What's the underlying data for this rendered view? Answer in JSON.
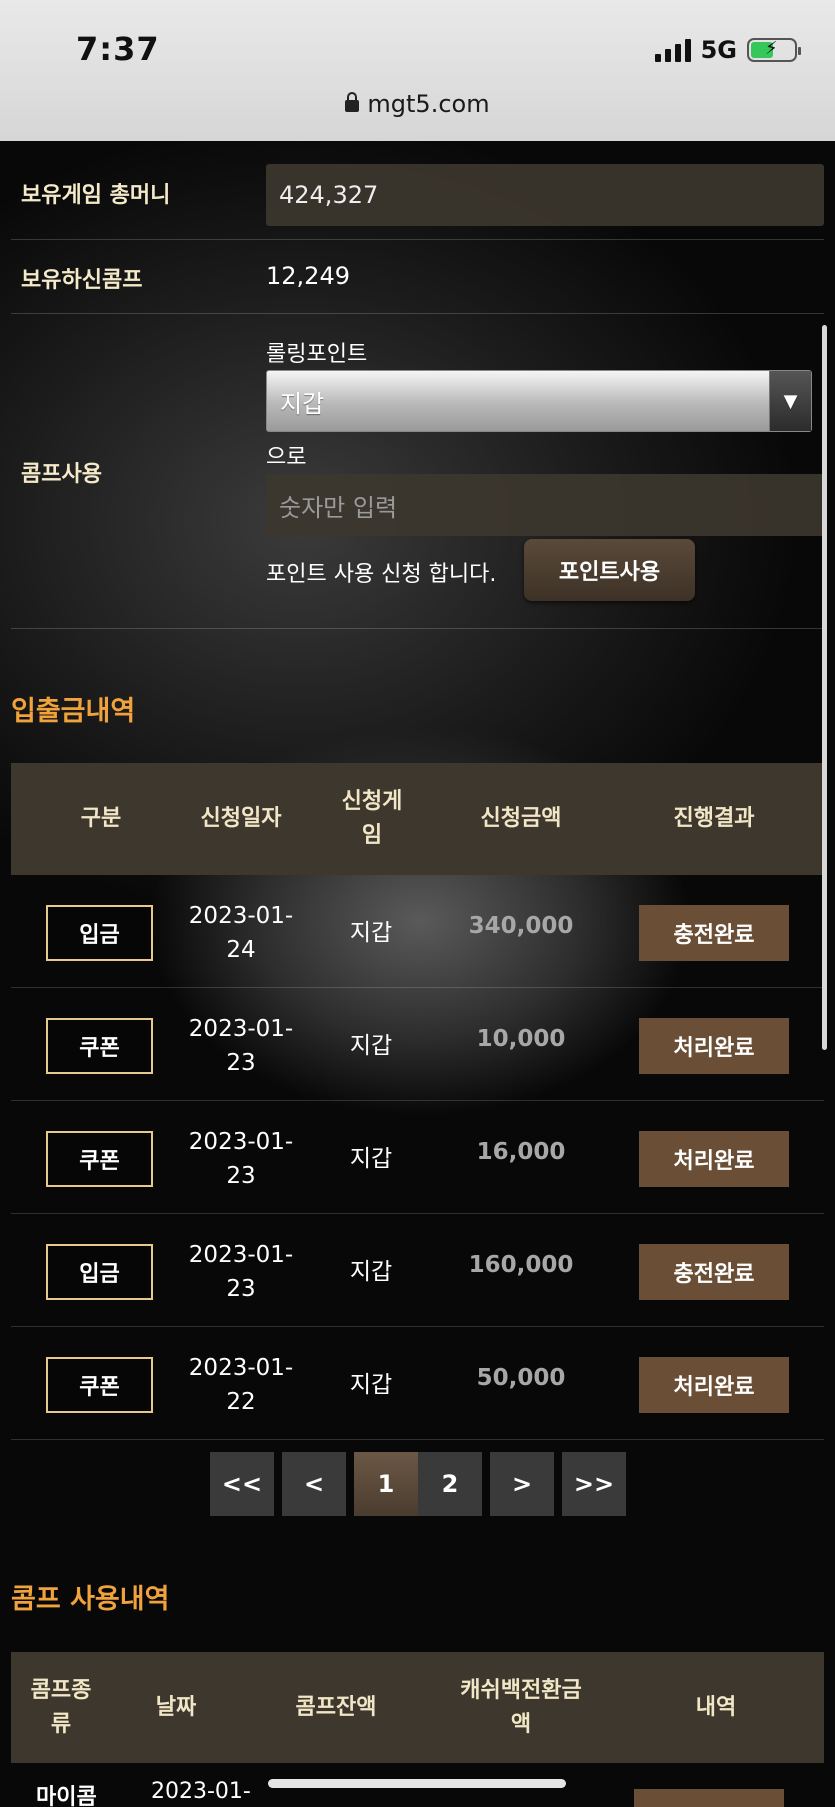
{
  "status_bar": {
    "time": "7:37",
    "network": "5G"
  },
  "browser": {
    "url": "mgt5.com"
  },
  "account": {
    "total_money_label": "보유게임 총머니",
    "total_money_value": "424,327",
    "comp_label": "보유하신콤프",
    "comp_value": "12,249",
    "comp_use_label": "콤프사용",
    "rolling_label": "롤링포인트",
    "wallet_select_value": "지갑",
    "to_text": "으로",
    "amount_placeholder": "숫자만 입력",
    "request_text": "포인트 사용 신청 합니다.",
    "use_button": "포인트사용"
  },
  "history": {
    "title": "입출금내역",
    "headers": [
      "구분",
      "신청일자",
      "신청게임",
      "신청금액",
      "진행결과"
    ],
    "rows": [
      {
        "type": "입금",
        "date": "2023-01-24",
        "game": "지갑",
        "amount": "340,000",
        "result": "충전완료"
      },
      {
        "type": "쿠폰",
        "date": "2023-01-23",
        "game": "지갑",
        "amount": "10,000",
        "result": "처리완료"
      },
      {
        "type": "쿠폰",
        "date": "2023-01-23",
        "game": "지갑",
        "amount": "16,000",
        "result": "처리완료"
      },
      {
        "type": "입금",
        "date": "2023-01-23",
        "game": "지갑",
        "amount": "160,000",
        "result": "충전완료"
      },
      {
        "type": "쿠폰",
        "date": "2023-01-22",
        "game": "지갑",
        "amount": "50,000",
        "result": "처리완료"
      }
    ],
    "pager": {
      "first": "<<",
      "prev": "<",
      "pages": [
        "1",
        "2"
      ],
      "current": "1",
      "next": ">",
      "last": ">>"
    }
  },
  "comp_history": {
    "title": "콤프 사용내역",
    "headers": [
      "콤프종류",
      "날짜",
      "콤프잔액",
      "캐쉬백전환금액",
      "내역"
    ],
    "first_row_partial": {
      "type": "마이콤",
      "date": "2023-01-"
    }
  }
}
